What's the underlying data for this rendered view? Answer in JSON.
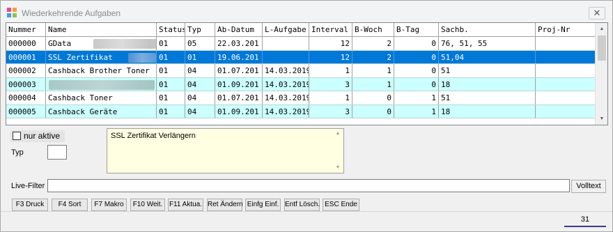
{
  "window": {
    "title": "Wiederkehrende Aufgaben",
    "close_label": "✕"
  },
  "grid": {
    "columns": [
      "Nummer",
      "Name",
      "Status",
      "Typ",
      "Ab-Datum",
      "L-Aufgabe",
      "Interval",
      "B-Woch",
      "B-Tag",
      "Sachb.",
      "Proj-Nr"
    ],
    "rows": [
      {
        "nummer": "000000",
        "name": "GData",
        "status": "01",
        "typ": "05",
        "ab_datum": "22.03.201",
        "l_aufgabe": "",
        "interval": "12",
        "b_woch": "2",
        "b_tag": "0",
        "sachb": "76, 51, 55",
        "proj_nr": ""
      },
      {
        "nummer": "000001",
        "name": "SSL Zertifikat",
        "status": "01",
        "typ": "01",
        "ab_datum": "19.06.201",
        "l_aufgabe": "",
        "interval": "12",
        "b_woch": "2",
        "b_tag": "0",
        "sachb": "51,04",
        "proj_nr": ""
      },
      {
        "nummer": "000002",
        "name": "Cashback Brother Toner",
        "status": "01",
        "typ": "04",
        "ab_datum": "01.07.201",
        "l_aufgabe": "14.03.2019",
        "interval": "1",
        "b_woch": "1",
        "b_tag": "0",
        "sachb": "51",
        "proj_nr": ""
      },
      {
        "nummer": "000003",
        "name": "",
        "status": "01",
        "typ": "04",
        "ab_datum": "01.09.201",
        "l_aufgabe": "14.03.2019",
        "interval": "3",
        "b_woch": "1",
        "b_tag": "0",
        "sachb": "18",
        "proj_nr": ""
      },
      {
        "nummer": "000004",
        "name": "Cashback Toner",
        "status": "01",
        "typ": "04",
        "ab_datum": "01.07.201",
        "l_aufgabe": "14.03.2019",
        "interval": "1",
        "b_woch": "0",
        "b_tag": "1",
        "sachb": "51",
        "proj_nr": ""
      },
      {
        "nummer": "000005",
        "name": "Cashback Geräte",
        "status": "01",
        "typ": "04",
        "ab_datum": "01.09.201",
        "l_aufgabe": "14.03.2019",
        "interval": "3",
        "b_woch": "0",
        "b_tag": "1",
        "sachb": "18",
        "proj_nr": ""
      }
    ]
  },
  "filter": {
    "nur_aktiv_label": "nur aktive",
    "typ_label": "Typ",
    "typ_value": "",
    "memo_text": "SSL Zertifikat Verlängern",
    "live_filter_label": "Live-Filter",
    "live_filter_value": "",
    "volltext_label": "Volltext"
  },
  "function_keys": [
    "F3 Druck",
    "F4 Sort",
    "F7 Makro",
    "F10 Weit.",
    "F11 Aktua.",
    "Ret Ändern",
    "Einfg Einf.",
    "Entf Lösch.",
    "ESC Ende"
  ],
  "status": {
    "count": "31"
  },
  "colors": {
    "selected_row": "#0078d7",
    "alt_row": "#ccffff",
    "memo_bg": "#ffffe1"
  }
}
